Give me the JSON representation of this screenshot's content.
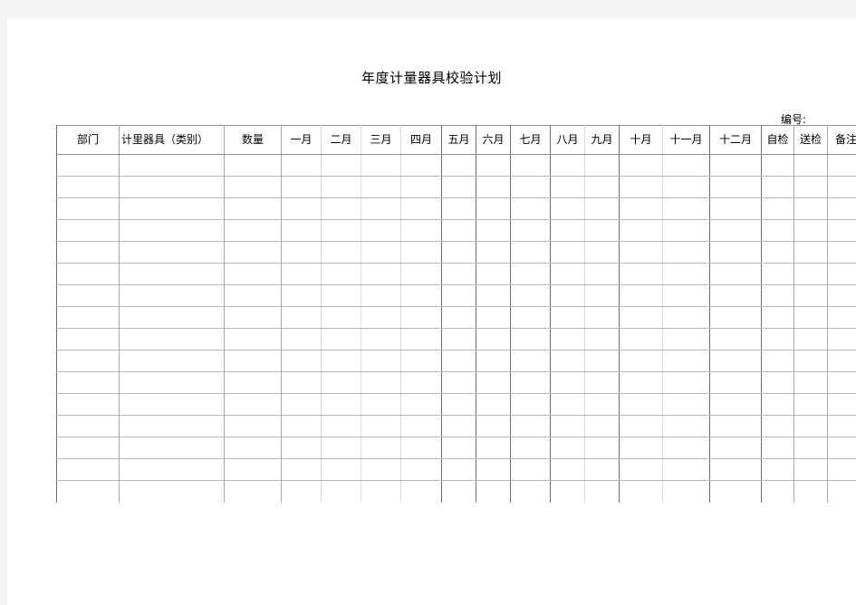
{
  "document": {
    "title": "年度计量器具校验计划",
    "serial_label": "编号:"
  },
  "table": {
    "headers": [
      "部门",
      "计里器具（类别）",
      "数量",
      "一月",
      "二月",
      "三月",
      "四月",
      "五月",
      "六月",
      "七月",
      "八月",
      "九月",
      "十月",
      "十一月",
      "十二月",
      "自检",
      "送检",
      "备注"
    ],
    "row_count": 16,
    "rows": [
      [
        "",
        "",
        "",
        "",
        "",
        "",
        "",
        "",
        "",
        "",
        "",
        "",
        "",
        "",
        "",
        "",
        "",
        ""
      ],
      [
        "",
        "",
        "",
        "",
        "",
        "",
        "",
        "",
        "",
        "",
        "",
        "",
        "",
        "",
        "",
        "",
        "",
        ""
      ],
      [
        "",
        "",
        "",
        "",
        "",
        "",
        "",
        "",
        "",
        "",
        "",
        "",
        "",
        "",
        "",
        "",
        "",
        ""
      ],
      [
        "",
        "",
        "",
        "",
        "",
        "",
        "",
        "",
        "",
        "",
        "",
        "",
        "",
        "",
        "",
        "",
        "",
        ""
      ],
      [
        "",
        "",
        "",
        "",
        "",
        "",
        "",
        "",
        "",
        "",
        "",
        "",
        "",
        "",
        "",
        "",
        "",
        ""
      ],
      [
        "",
        "",
        "",
        "",
        "",
        "",
        "",
        "",
        "",
        "",
        "",
        "",
        "",
        "",
        "",
        "",
        "",
        ""
      ],
      [
        "",
        "",
        "",
        "",
        "",
        "",
        "",
        "",
        "",
        "",
        "",
        "",
        "",
        "",
        "",
        "",
        "",
        ""
      ],
      [
        "",
        "",
        "",
        "",
        "",
        "",
        "",
        "",
        "",
        "",
        "",
        "",
        "",
        "",
        "",
        "",
        "",
        ""
      ],
      [
        "",
        "",
        "",
        "",
        "",
        "",
        "",
        "",
        "",
        "",
        "",
        "",
        "",
        "",
        "",
        "",
        "",
        ""
      ],
      [
        "",
        "",
        "",
        "",
        "",
        "",
        "",
        "",
        "",
        "",
        "",
        "",
        "",
        "",
        "",
        "",
        "",
        ""
      ],
      [
        "",
        "",
        "",
        "",
        "",
        "",
        "",
        "",
        "",
        "",
        "",
        "",
        "",
        "",
        "",
        "",
        "",
        ""
      ],
      [
        "",
        "",
        "",
        "",
        "",
        "",
        "",
        "",
        "",
        "",
        "",
        "",
        "",
        "",
        "",
        "",
        "",
        ""
      ],
      [
        "",
        "",
        "",
        "",
        "",
        "",
        "",
        "",
        "",
        "",
        "",
        "",
        "",
        "",
        "",
        "",
        "",
        ""
      ],
      [
        "",
        "",
        "",
        "",
        "",
        "",
        "",
        "",
        "",
        "",
        "",
        "",
        "",
        "",
        "",
        "",
        "",
        ""
      ],
      [
        "",
        "",
        "",
        "",
        "",
        "",
        "",
        "",
        "",
        "",
        "",
        "",
        "",
        "",
        "",
        "",
        "",
        ""
      ],
      [
        "",
        "",
        "",
        "",
        "",
        "",
        "",
        "",
        "",
        "",
        "",
        "",
        "",
        "",
        "",
        "",
        "",
        ""
      ]
    ]
  },
  "colors": {
    "page_background": "#ffffff",
    "canvas_background": "#f4f4f4",
    "grid_light": "#b6b6b6",
    "grid_dark": "#6e6e6e",
    "text": "#000000"
  }
}
